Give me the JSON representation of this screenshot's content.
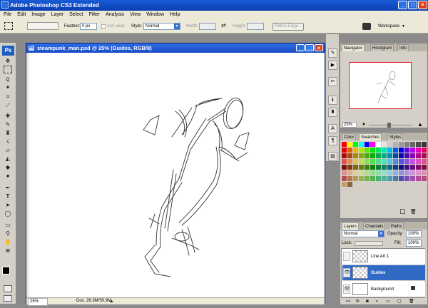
{
  "app": {
    "title": "Adobe Photoshop CS3 Extended"
  },
  "menu": [
    "File",
    "Edit",
    "Image",
    "Layer",
    "Select",
    "Filter",
    "Analysis",
    "View",
    "Window",
    "Help"
  ],
  "options": {
    "feather_label": "Feather:",
    "feather_value": "0 px",
    "antialias_label": "Anti-alias",
    "style_label": "Style:",
    "style_value": "Normal",
    "width_label": "Width:",
    "height_label": "Height:",
    "refine_label": "Refine Edge...",
    "workspace_label": "Workspace"
  },
  "toolbox": {
    "logo": "Ps"
  },
  "document": {
    "title": "steampunk_man.psd @ 25% (Guides, RGB/8)",
    "zoom": "25%",
    "doc_info": "Doc: 26.3M/50.9M"
  },
  "navigator": {
    "tabs": [
      "Navigator",
      "Histogram",
      "Info"
    ],
    "zoom": "25%"
  },
  "swatches_panel": {
    "tabs": [
      "Color",
      "Swatches",
      "Styles"
    ]
  },
  "layers_panel": {
    "tabs": [
      "Layers",
      "Channels",
      "Paths"
    ],
    "blend_mode": "Normal",
    "opacity_label": "Opacity:",
    "opacity_value": "100%",
    "lock_label": "Lock:",
    "fill_label": "Fill:",
    "fill_value": "100%",
    "layers": [
      {
        "name": "Line Art 1",
        "visible": false,
        "selected": false
      },
      {
        "name": "Guides",
        "visible": true,
        "selected": true
      },
      {
        "name": "Background",
        "visible": true,
        "selected": false,
        "locked": true
      }
    ]
  },
  "colors": {
    "selection": "#316ac5",
    "title_bar": "#1a4cc4",
    "navigator_frame": "#e02020"
  }
}
